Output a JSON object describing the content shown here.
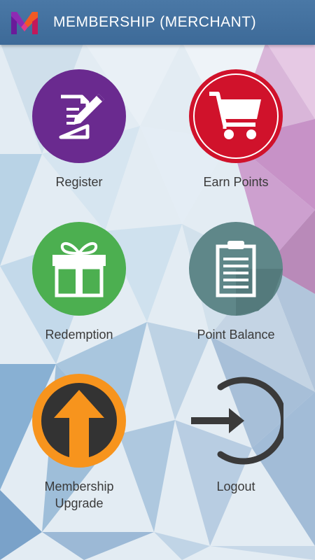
{
  "header": {
    "title": "MEMBERSHIP (MERCHANT)",
    "logo_icon": "m-logo-icon"
  },
  "menu": {
    "register": {
      "label": "Register",
      "icon": "edit-document-icon",
      "color": "#6a2a8f"
    },
    "earn_points": {
      "label": "Earn Points",
      "icon": "shopping-cart-icon",
      "color": "#d0122b"
    },
    "redemption": {
      "label": "Redemption",
      "icon": "gift-icon",
      "color": "#4caf50"
    },
    "point_balance": {
      "label": "Point Balance",
      "icon": "clipboard-icon",
      "color": "#5f8789"
    },
    "membership_upgrade": {
      "label_line1": "Membership",
      "label_line2": "Upgrade",
      "icon": "arrow-up-icon",
      "color": "#f7941d"
    },
    "logout": {
      "label": "Logout",
      "icon": "logout-icon",
      "color": "#3a3a3a"
    }
  },
  "colors": {
    "app_bar": "#4a78a6",
    "label_text": "#3a3a3a"
  }
}
